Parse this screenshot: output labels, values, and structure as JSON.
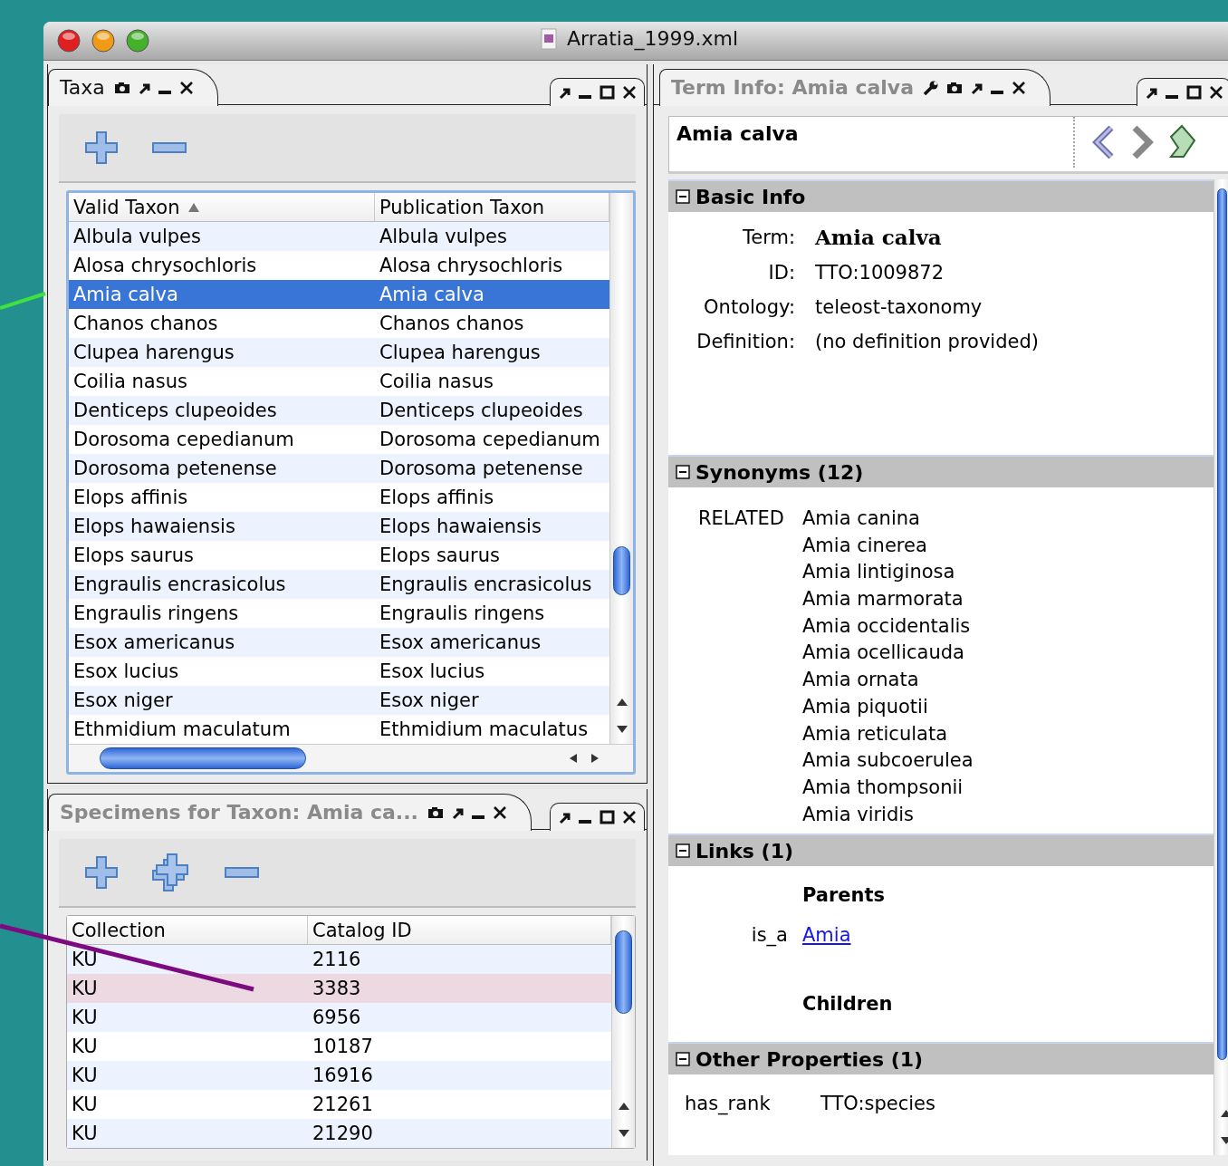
{
  "window": {
    "title": "Arratia_1999.xml"
  },
  "taxa_panel": {
    "tab": "Taxa",
    "table": {
      "columns": [
        {
          "label": "Valid Taxon",
          "sorted": true
        },
        {
          "label": "Publication Taxon",
          "sorted": false
        }
      ],
      "rows": [
        {
          "cells": [
            "Albula vulpes",
            "Albula vulpes"
          ],
          "selected": false
        },
        {
          "cells": [
            "Alosa chrysochloris",
            "Alosa chrysochloris"
          ],
          "selected": false
        },
        {
          "cells": [
            "Amia calva",
            "Amia calva"
          ],
          "selected": true
        },
        {
          "cells": [
            "Chanos chanos",
            "Chanos chanos"
          ],
          "selected": false
        },
        {
          "cells": [
            "Clupea harengus",
            "Clupea harengus"
          ],
          "selected": false
        },
        {
          "cells": [
            "Coilia nasus",
            "Coilia nasus"
          ],
          "selected": false
        },
        {
          "cells": [
            "Denticeps clupeoides",
            "Denticeps clupeoides"
          ],
          "selected": false
        },
        {
          "cells": [
            "Dorosoma cepedianum",
            "Dorosoma cepedianum"
          ],
          "selected": false
        },
        {
          "cells": [
            "Dorosoma petenense",
            "Dorosoma petenense"
          ],
          "selected": false
        },
        {
          "cells": [
            "Elops affinis",
            "Elops affinis"
          ],
          "selected": false
        },
        {
          "cells": [
            "Elops hawaiensis",
            "Elops hawaiensis"
          ],
          "selected": false
        },
        {
          "cells": [
            "Elops saurus",
            "Elops saurus"
          ],
          "selected": false
        },
        {
          "cells": [
            "Engraulis encrasicolus",
            "Engraulis encrasicolus"
          ],
          "selected": false
        },
        {
          "cells": [
            "Engraulis ringens",
            "Engraulis ringens"
          ],
          "selected": false
        },
        {
          "cells": [
            "Esox americanus",
            "Esox americanus"
          ],
          "selected": false
        },
        {
          "cells": [
            "Esox lucius",
            "Esox lucius"
          ],
          "selected": false
        },
        {
          "cells": [
            "Esox niger",
            "Esox niger"
          ],
          "selected": false
        },
        {
          "cells": [
            "Ethmidium maculatum",
            "Ethmidium maculatus"
          ],
          "selected": false
        }
      ]
    }
  },
  "specimens_panel": {
    "tab": "Specimens for Taxon: Amia ca...",
    "table": {
      "columns": [
        {
          "label": "Collection",
          "sorted": false
        },
        {
          "label": "Catalog ID",
          "sorted": false
        }
      ],
      "rows": [
        {
          "cells": [
            "KU",
            "2116"
          ],
          "selected": false
        },
        {
          "cells": [
            "KU",
            "3383"
          ],
          "selected": true
        },
        {
          "cells": [
            "KU",
            "6956"
          ],
          "selected": false
        },
        {
          "cells": [
            "KU",
            "10187"
          ],
          "selected": false
        },
        {
          "cells": [
            "KU",
            "16916"
          ],
          "selected": false
        },
        {
          "cells": [
            "KU",
            "21261"
          ],
          "selected": false
        },
        {
          "cells": [
            "KU",
            "21290"
          ],
          "selected": false
        }
      ]
    }
  },
  "term_info": {
    "tab": "Term Info: Amia calva",
    "term_title": "Amia calva",
    "sections": [
      {
        "kind": "fields",
        "title": "Basic Info",
        "expanded": true,
        "fields": [
          {
            "label": "Term:",
            "value": "Amia calva"
          },
          {
            "label": "ID:",
            "value": "TTO:1009872"
          },
          {
            "label": "Ontology:",
            "value": "teleost-taxonomy"
          },
          {
            "label": "Definition:",
            "value": "(no definition provided)"
          }
        ]
      },
      {
        "kind": "synonyms",
        "title": "Synonyms (12)",
        "expanded": true,
        "groups": [
          {
            "type": "RELATED",
            "names": [
              "Amia canina",
              "Amia cinerea",
              "Amia lintiginosa",
              "Amia marmorata",
              "Amia occidentalis",
              "Amia ocellicauda",
              "Amia ornata",
              "Amia piquotii",
              "Amia reticulata",
              "Amia subcoerulea",
              "Amia thompsonii",
              "Amia viridis"
            ]
          }
        ]
      },
      {
        "kind": "links",
        "title": "Links (1)",
        "expanded": true,
        "groups": [
          {
            "heading": "Parents",
            "links": [
              {
                "relation": "is_a",
                "target": "Amia"
              }
            ]
          },
          {
            "heading": "Children"
          }
        ]
      },
      {
        "kind": "properties",
        "title": "Other Properties (1)",
        "expanded": true,
        "properties": [
          {
            "name": "has_rank",
            "value": "TTO:species"
          }
        ]
      }
    ]
  }
}
